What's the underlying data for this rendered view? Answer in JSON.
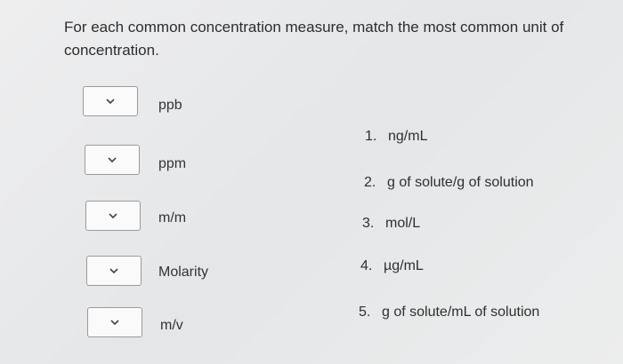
{
  "question": "For each common concentration measure, match the most common unit of concentration.",
  "terms": [
    {
      "label": "ppb",
      "selected": ""
    },
    {
      "label": "ppm",
      "selected": ""
    },
    {
      "label": "m/m",
      "selected": ""
    },
    {
      "label": "Molarity",
      "selected": ""
    },
    {
      "label": "m/v",
      "selected": ""
    }
  ],
  "options": [
    {
      "num": "1.",
      "text": "ng/mL"
    },
    {
      "num": "2.",
      "text": "g of solute/g of solution"
    },
    {
      "num": "3.",
      "text": "mol/L"
    },
    {
      "num": "4.",
      "text": "µg/mL"
    },
    {
      "num": "5.",
      "text": "g of solute/mL of solution"
    }
  ],
  "icons": {
    "dropdown": "chevron-down-icon"
  }
}
